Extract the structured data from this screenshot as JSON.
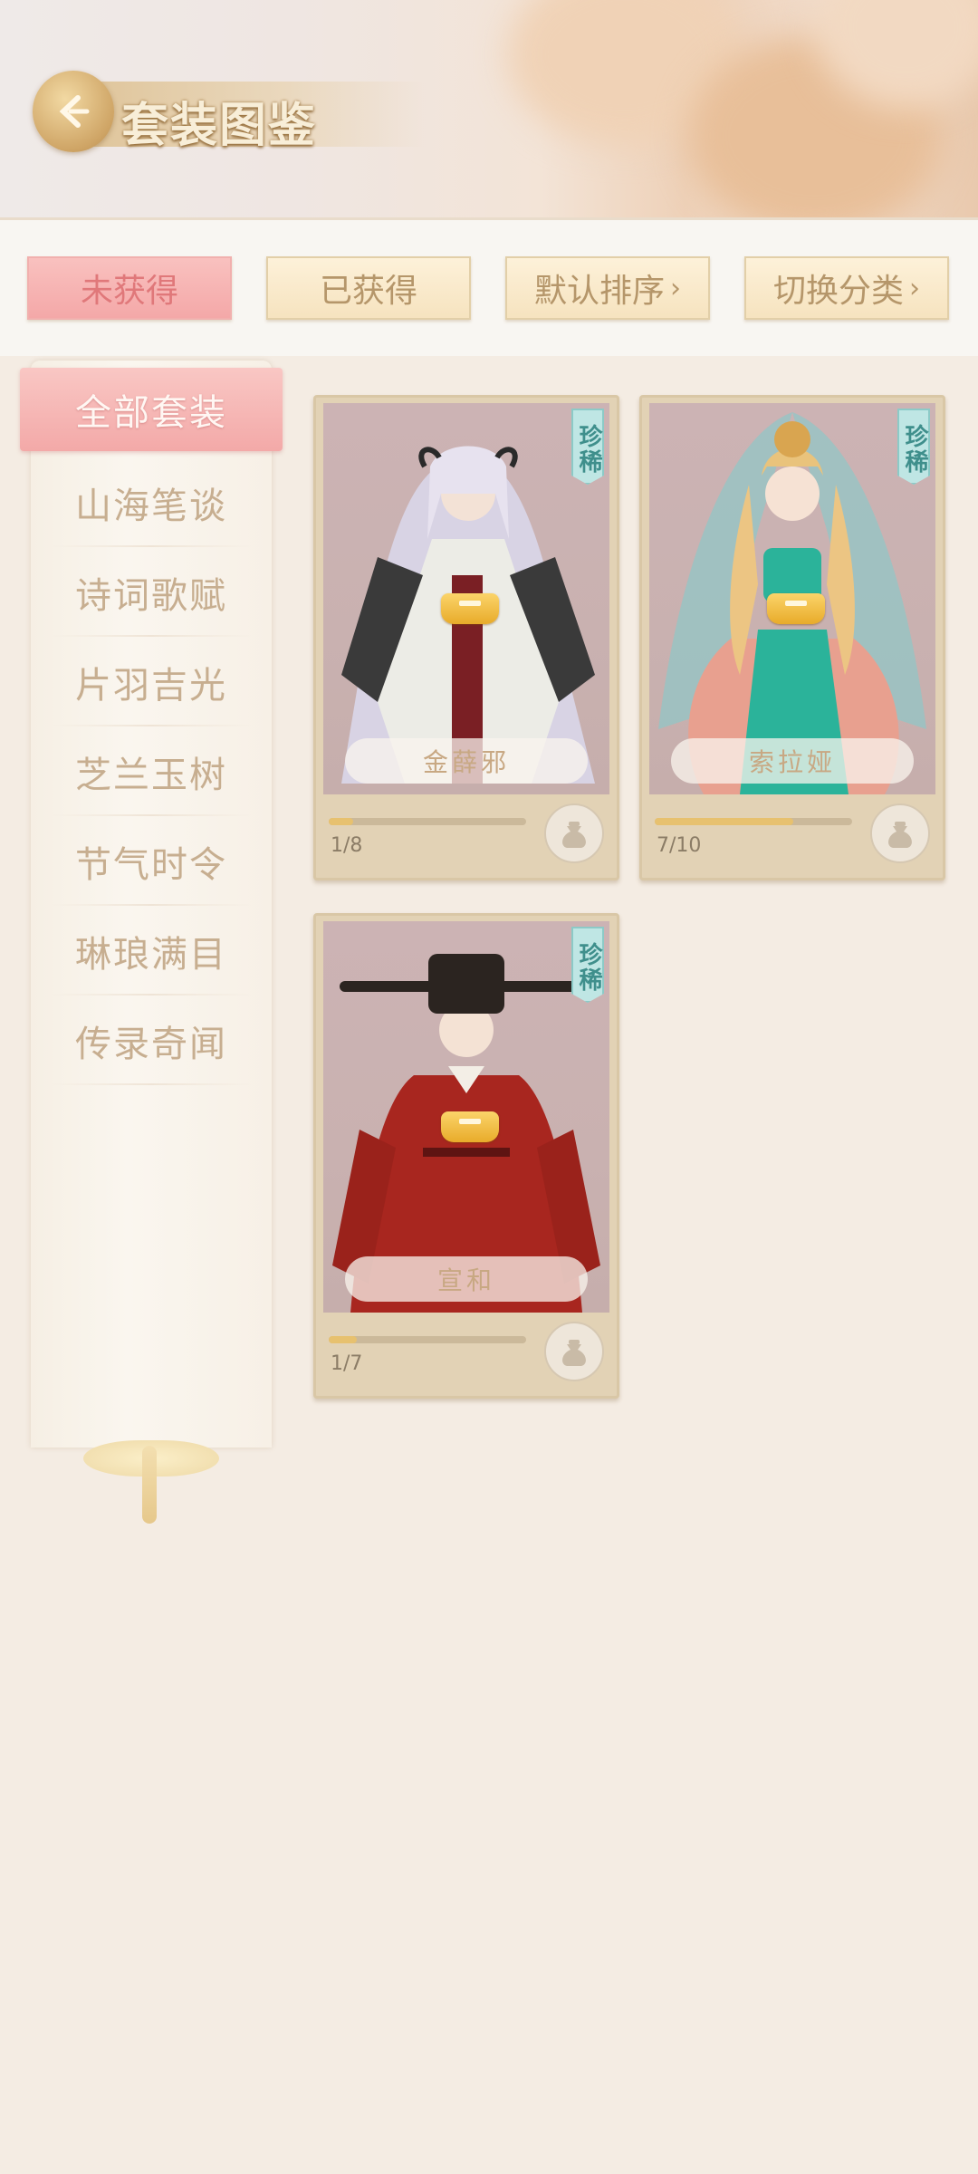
{
  "header": {
    "title": "套装图鉴"
  },
  "filters": {
    "not_obtained": "未获得",
    "obtained": "已获得",
    "sort": "默认排序",
    "category": "切换分类",
    "chevron": "›"
  },
  "sidebar": {
    "items": [
      {
        "label": "全部套装",
        "active": true
      },
      {
        "label": "山海笔谈"
      },
      {
        "label": "诗词歌赋"
      },
      {
        "label": "片羽吉光"
      },
      {
        "label": "芝兰玉树"
      },
      {
        "label": "节气时令"
      },
      {
        "label": "琳琅满目"
      },
      {
        "label": "传录奇闻"
      }
    ]
  },
  "cards": [
    {
      "name": "金薛邪",
      "rarity": "珍稀",
      "progress_text": "1/8",
      "progress": 0.125
    },
    {
      "name": "索拉娅",
      "rarity": "珍稀",
      "progress_text": "7/10",
      "progress": 0.7
    },
    {
      "name": "宣和",
      "rarity": "珍稀",
      "progress_text": "1/7",
      "progress": 0.1429
    }
  ],
  "colors": {
    "accent_pink": "#f3a9a8",
    "gold": "#e7c16f",
    "background": "#f4ece3",
    "rare_badge": "#bfe6e4"
  },
  "icons": {
    "back": "back-arrow-icon",
    "lock": "lock-icon",
    "bag": "bag-icon"
  }
}
